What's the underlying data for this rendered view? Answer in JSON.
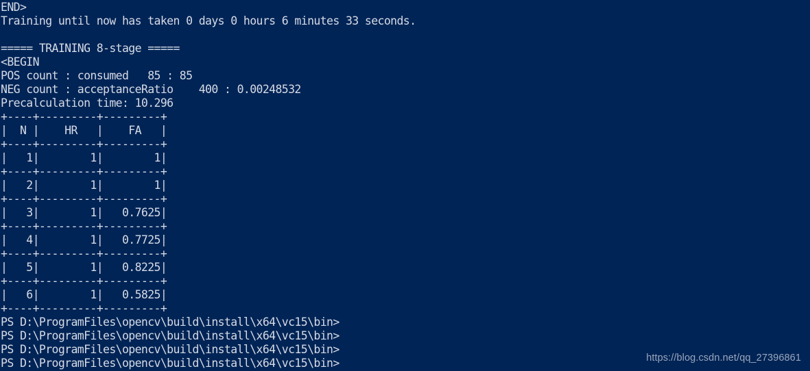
{
  "console": {
    "background_color": "#012456",
    "text_color": "#d6dbe6",
    "lines": [
      {
        "id": "end-marker",
        "text": "END>"
      },
      {
        "id": "training-elapsed",
        "text": "Training until now has taken 0 days 0 hours 6 minutes 33 seconds."
      },
      {
        "id": "blank-1",
        "text": ""
      },
      {
        "id": "stage-header",
        "text": "===== TRAINING 8-stage ====="
      },
      {
        "id": "begin-marker",
        "text": "<BEGIN"
      },
      {
        "id": "pos-count",
        "text": "POS count : consumed   85 : 85"
      },
      {
        "id": "neg-count",
        "text": "NEG count : acceptanceRatio    400 : 0.00248532"
      },
      {
        "id": "precalculation",
        "text": "Precalculation time: 10.296"
      },
      {
        "id": "table-sep-top",
        "text": "+----+---------+---------+"
      },
      {
        "id": "table-header",
        "text": "|  N |    HR   |    FA   |"
      },
      {
        "id": "table-sep-1",
        "text": "+----+---------+---------+"
      },
      {
        "id": "table-row-1",
        "text": "|   1|        1|        1|"
      },
      {
        "id": "table-sep-2",
        "text": "+----+---------+---------+"
      },
      {
        "id": "table-row-2",
        "text": "|   2|        1|        1|"
      },
      {
        "id": "table-sep-3",
        "text": "+----+---------+---------+"
      },
      {
        "id": "table-row-3",
        "text": "|   3|        1|   0.7625|"
      },
      {
        "id": "table-sep-4",
        "text": "+----+---------+---------+"
      },
      {
        "id": "table-row-4",
        "text": "|   4|        1|   0.7725|"
      },
      {
        "id": "table-sep-5",
        "text": "+----+---------+---------+"
      },
      {
        "id": "table-row-5",
        "text": "|   5|        1|   0.8225|"
      },
      {
        "id": "table-sep-6",
        "text": "+----+---------+---------+"
      },
      {
        "id": "table-row-6",
        "text": "|   6|        1|   0.5825|"
      },
      {
        "id": "table-sep-bottom",
        "text": "+----+---------+---------+"
      },
      {
        "id": "prompt-1",
        "text": "PS D:\\ProgramFiles\\opencv\\build\\install\\x64\\vc15\\bin>"
      },
      {
        "id": "prompt-2",
        "text": "PS D:\\ProgramFiles\\opencv\\build\\install\\x64\\vc15\\bin>"
      },
      {
        "id": "prompt-3",
        "text": "PS D:\\ProgramFiles\\opencv\\build\\install\\x64\\vc15\\bin>"
      },
      {
        "id": "prompt-4",
        "text": "PS D:\\ProgramFiles\\opencv\\build\\install\\x64\\vc15\\bin>"
      }
    ],
    "training_table": {
      "columns": [
        "N",
        "HR",
        "FA"
      ],
      "rows": [
        {
          "N": "1",
          "HR": "1",
          "FA": "1"
        },
        {
          "N": "2",
          "HR": "1",
          "FA": "1"
        },
        {
          "N": "3",
          "HR": "1",
          "FA": "0.7625"
        },
        {
          "N": "4",
          "HR": "1",
          "FA": "0.7725"
        },
        {
          "N": "5",
          "HR": "1",
          "FA": "0.8225"
        },
        {
          "N": "6",
          "HR": "1",
          "FA": "0.5825"
        }
      ]
    },
    "stage_info": {
      "stage_label": "TRAINING 8-stage",
      "elapsed_days": "0",
      "elapsed_hours": "0",
      "elapsed_minutes": "6",
      "elapsed_seconds": "33",
      "pos_count": "85",
      "pos_consumed": "85",
      "neg_count": "400",
      "acceptance_ratio": "0.00248532",
      "precalculation_time": "10.296"
    },
    "prompt_path": "PS D:\\ProgramFiles\\opencv\\build\\install\\x64\\vc15\\bin>"
  },
  "watermark": {
    "text": "https://blog.csdn.net/qq_27396861",
    "color": "#9aa7bd"
  }
}
